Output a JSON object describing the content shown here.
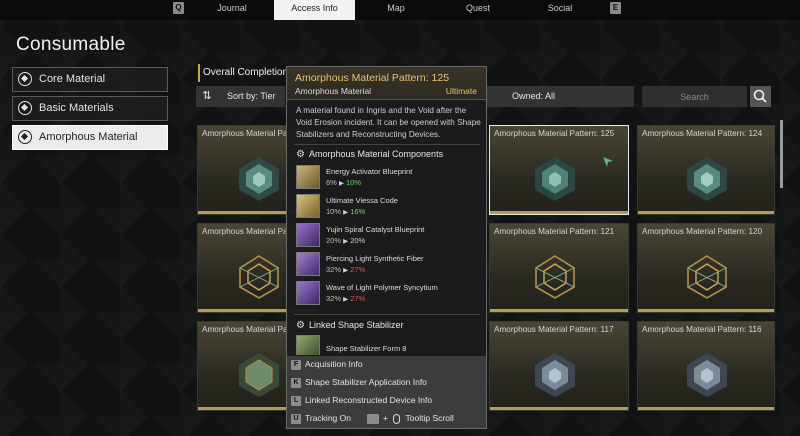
{
  "nav": {
    "left_key": "Q",
    "right_key": "E",
    "tabs": [
      {
        "label": "Journal"
      },
      {
        "label": "Access Info"
      },
      {
        "label": "Map"
      },
      {
        "label": "Quest"
      },
      {
        "label": "Social"
      }
    ],
    "active_tab": "Access Info"
  },
  "page": {
    "title": "Consumable"
  },
  "categories": [
    {
      "label": "Core Material",
      "selected": false
    },
    {
      "label": "Basic Materials",
      "selected": false
    },
    {
      "label": "Amorphous Material",
      "selected": true
    }
  ],
  "toolbar": {
    "completion_label": "Overall Completion",
    "sort_label": "Sort by: Tier",
    "owned_label": "Owned: All",
    "search_placeholder": "Search"
  },
  "grid": {
    "rows": [
      [
        "Amorphous Material Pa",
        "Amorphous Material Pattern: 125",
        "Amorphous Material Pattern: 124"
      ],
      [
        "Amorphous Material Pa",
        "Amorphous Material Pattern: 121",
        "Amorphous Material Pattern: 120"
      ],
      [
        "Amorphous Material Pa",
        "Amorphous Material Pattern: 117",
        "Amorphous Material Pattern: 116"
      ]
    ]
  },
  "tooltip": {
    "title": "Amorphous Material Pattern: 125",
    "subtitle": "Amorphous Material",
    "rarity": "Ultimate",
    "description": "A material found in Ingris and the Void after the Void Erosion incident. It can be opened with Shape Stabilizers and Reconstructing Devices.",
    "components_header": "Amorphous Material Components",
    "components": [
      {
        "name": "Energy Activator Blueprint",
        "from": "6%",
        "to": "10%",
        "trend": "up"
      },
      {
        "name": "Ultimate Viessa Code",
        "from": "10%",
        "to": "16%",
        "trend": "up"
      },
      {
        "name": "Yujin Spiral Catalyst Blueprint",
        "from": "20%",
        "to": "20%",
        "trend": "same"
      },
      {
        "name": "Piercing Light Synthetic Fiber",
        "from": "32%",
        "to": "27%",
        "trend": "down"
      },
      {
        "name": "Wave of Light Polymer Syncytium",
        "from": "32%",
        "to": "27%",
        "trend": "down"
      }
    ],
    "linked_header": "Linked Shape Stabilizer",
    "linked_item": "Shape Stabilizer Form 8",
    "actions": [
      {
        "key": "F",
        "label": "Acquisition Info"
      },
      {
        "key": "K",
        "label": "Shape Stabilizer Application Info"
      },
      {
        "key": "L",
        "label": "Linked Reconstructed Device Info"
      }
    ],
    "tracking": {
      "key": "U",
      "label": "Tracking On"
    },
    "scroll_hint": "Tooltip Scroll"
  }
}
